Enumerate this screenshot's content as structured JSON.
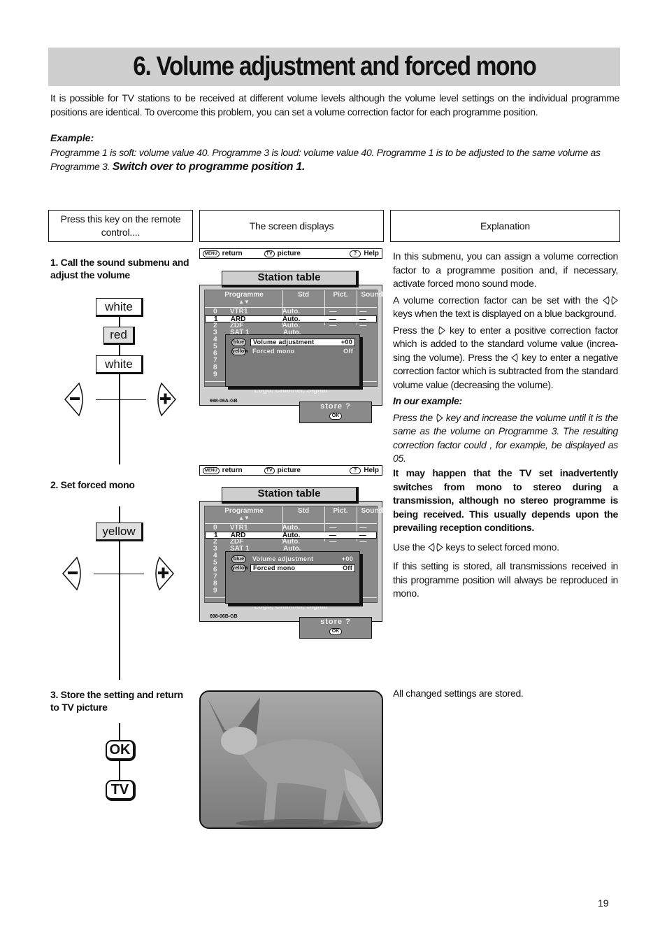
{
  "title": "6. Volume adjustment and forced mono",
  "intro": "It is possible for TV stations to be received at different volume levels although the volume level settings on the individual programme positions are identical. To overcome this problem, you can set a volume correction factor for each programme position.",
  "example": {
    "heading": "Example:",
    "text": "Programme 1 is soft: volume value 40. Programme 3 is loud: volume value 40. Programme 1 is to be adjusted to the same volume as Programme 3.",
    "emphasis": "Switch over to programme position 1."
  },
  "column_headers": {
    "press_key": "Press this key on the remote control....",
    "screen": "The screen displays",
    "explanation": "Explanation"
  },
  "steps": [
    {
      "label": "1. Call the sound submenu and adjust the volume",
      "keys": [
        "white",
        "red",
        "white"
      ],
      "minus": "−",
      "plus": "+"
    },
    {
      "label": "2. Set forced mono",
      "keys": [
        "yellow"
      ],
      "minus": "−",
      "plus": "+"
    },
    {
      "label": "3. Store the setting and return to TV picture",
      "keys": [
        "OK",
        "TV"
      ]
    }
  ],
  "osd": {
    "top_bar": {
      "menu_pill": "MENU",
      "return": "return",
      "tv_pill": "TV",
      "picture": "picture",
      "help_pill": "?",
      "help": "Help"
    },
    "station_table_title": "Station table",
    "headers": {
      "programme": "Programme",
      "arrows": "▲▼",
      "std": "Std",
      "pict": "Pict.",
      "sound": "Sound"
    },
    "rows": [
      {
        "num": "0",
        "name": "VTR1",
        "std": "Auto.",
        "pict": "—",
        "sound": "—"
      },
      {
        "num": "1",
        "name": "ARD",
        "std": "Auto.",
        "pict": "—",
        "sound": "—"
      },
      {
        "num": "2",
        "name": "ZDF",
        "std": "Auto.",
        "pict": "—",
        "sound": "—"
      },
      {
        "num": "3",
        "name": "SAT 1",
        "std": "Auto.",
        "pict": "—",
        "sound": "—"
      }
    ],
    "empty_rows": [
      "4",
      "5",
      "6",
      "7",
      "8",
      "9"
    ],
    "popup": [
      {
        "pill": "blue",
        "label": "Volume adjustment",
        "value": "+00"
      },
      {
        "pill": "yellow",
        "label": "Forced mono",
        "value": "Off"
      }
    ],
    "footer": "Logo, Channel, Signal",
    "store": "store ?",
    "ok_pill": "OK",
    "codes": [
      "698-06A-GB",
      "698-06B-GB"
    ]
  },
  "explanation": {
    "step1": {
      "p1": "In this submenu, you can assign a volume correction factor to a programme position and, if necessary, activate forced mono sound mode.",
      "p2a": "A volume correction factor can be set with the",
      "p2b": "keys when the text is displayed on a blue background.",
      "p3a": "Press the",
      "p3b": "key to enter a positive correction factor which is added to the standard volume value (increa-sing the volume). Press the",
      "p3c": "key to enter a negative correction factor which is subtracted from the standard volume value (decreasing the volume).",
      "example_heading": "In our example:",
      "p4a": "Press the",
      "p4b": "key and increase the volume until it is the same as the volume on Programme 3. The resulting correction factor could , for example, be displayed as 05."
    },
    "step2": {
      "bold": "It may happen that the TV set inadvertently switches from mono to stereo during a transmission, although no stereo programme is being received. This usually depends upon the prevailing reception conditions.",
      "p2a": "Use the",
      "p2b": "keys to select forced mono.",
      "p3": "If this setting is stored, all transmissions received in this programme position will always be reproduced in mono."
    },
    "step3": "All changed settings are stored."
  },
  "page_number": "19"
}
